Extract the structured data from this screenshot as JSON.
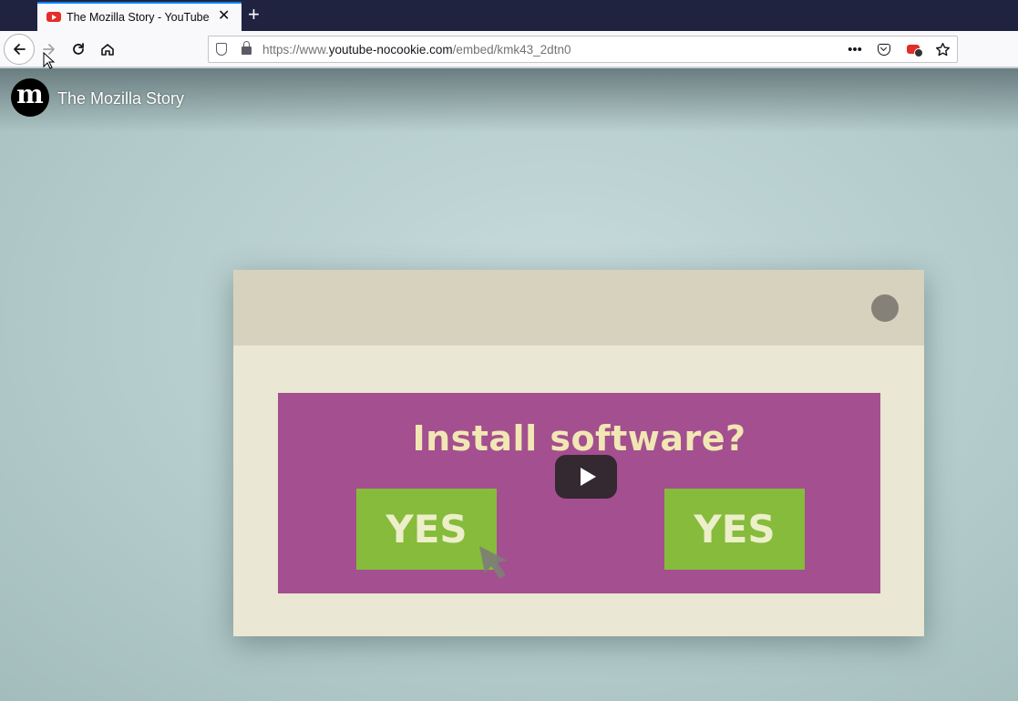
{
  "browser": {
    "tab": {
      "title": "The Mozilla Story - YouTube",
      "favicon": "youtube-icon",
      "close": "✕"
    },
    "new_tab": "+",
    "nav": {
      "back": "←",
      "forward": "→",
      "reload": "↻",
      "home": "⌂"
    },
    "url": {
      "scheme": "https://www.",
      "host": "youtube-nocookie.com",
      "path": "/embed/kmk43_2dtn0"
    },
    "url_actions": {
      "more": "•••"
    }
  },
  "video": {
    "channel_letter": "m",
    "title": "The Mozilla Story",
    "frame": {
      "question": "Install software?",
      "yes_left": "YES",
      "yes_right": "YES"
    }
  },
  "colors": {
    "tabstrip": "#202340",
    "accent": "#0a84ff",
    "panel_purple": "#a44f8f",
    "yes_green": "#86bb3b",
    "youtube_red": "#e52d27"
  }
}
